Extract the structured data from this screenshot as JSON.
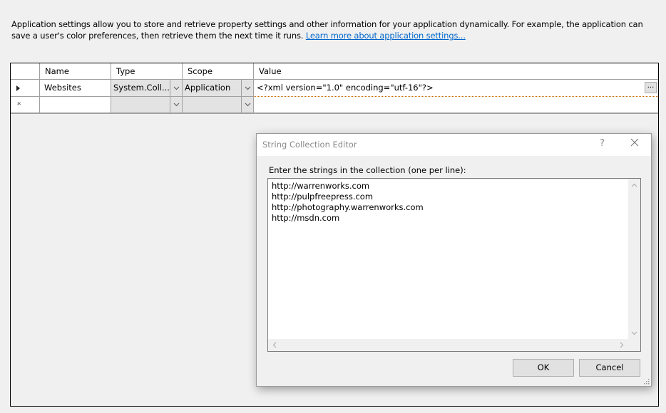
{
  "description": {
    "text": "Application settings allow you to store and retrieve property settings and other information for your application dynamically. For example, the application can save a user's color preferences, then retrieve them the next time it runs. ",
    "link": "Learn more about application settings..."
  },
  "grid": {
    "columns": [
      "",
      "Name",
      "Type",
      "Scope",
      "Value"
    ],
    "rows": [
      {
        "indicator": "current-row",
        "name": "Websites",
        "type": "System.Coll...",
        "scope": "Application",
        "value": "<?xml version=\"1.0\" encoding=\"utf-16\"?>",
        "ellipsis": "..."
      },
      {
        "indicator": "*",
        "name": "",
        "type": "",
        "scope": "",
        "value": ""
      }
    ]
  },
  "dialog": {
    "title": "String Collection Editor",
    "help": "?",
    "label": "Enter the strings in the collection (one per line):",
    "lines": [
      "http://warrenworks.com",
      "http://pulpfreepress.com",
      "http://photography.warrenworks.com",
      "http://msdn.com"
    ],
    "ok_label": "OK",
    "cancel_label": "Cancel"
  },
  "icons": {
    "up": "⌃",
    "down": "⌄",
    "left": "<",
    "right": ">"
  }
}
